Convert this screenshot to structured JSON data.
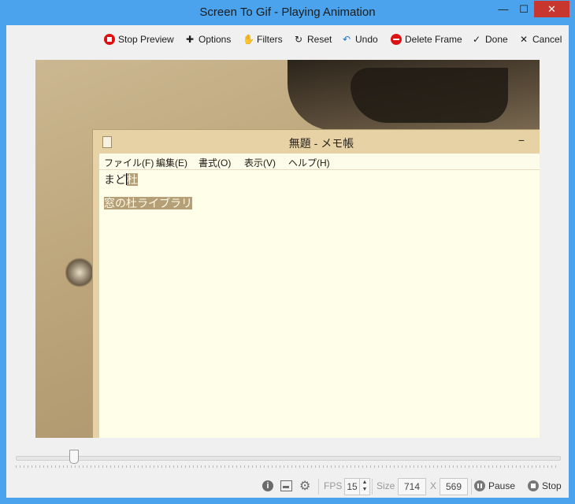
{
  "window": {
    "title": "Screen To Gif - Playing Animation",
    "min_glyph": "—",
    "max_glyph": "☐",
    "close_glyph": "✕"
  },
  "toolbar": {
    "stop_preview": "Stop Preview",
    "options": "Options",
    "filters": "Filters",
    "reset": "Reset",
    "undo": "Undo",
    "delete_frame": "Delete Frame",
    "done": "Done",
    "cancel": "Cancel",
    "icons": {
      "options": "✚",
      "filters": "✋",
      "reset": "↻",
      "undo": "↶",
      "done": "✓",
      "cancel": "✕"
    }
  },
  "notepad": {
    "title": "無題 - メモ帳",
    "min_glyph": "−",
    "menu": [
      "ファイル(F)",
      "編集(E)",
      "書式(O)",
      "表示(V)",
      "ヘルプ(H)"
    ],
    "line1_plain": "まど",
    "line1_selected": "杜",
    "line2_selected": "窓の杜ライブラリ"
  },
  "playback": {
    "frame_fraction": 0.1
  },
  "status": {
    "info_glyph": "i",
    "gear_glyph": "⚙",
    "fps_label": "FPS",
    "fps_value": "15",
    "size_label": "Size",
    "width": "714",
    "size_separator": "X",
    "height": "569",
    "pause": "Pause",
    "stop": "Stop",
    "spin_up": "▲",
    "spin_down": "▼"
  },
  "colors": {
    "accent": "#4aa3ec",
    "close_red": "#c7372f",
    "stop_red": "#dd1111",
    "sepia_background": "#c3ae86"
  }
}
